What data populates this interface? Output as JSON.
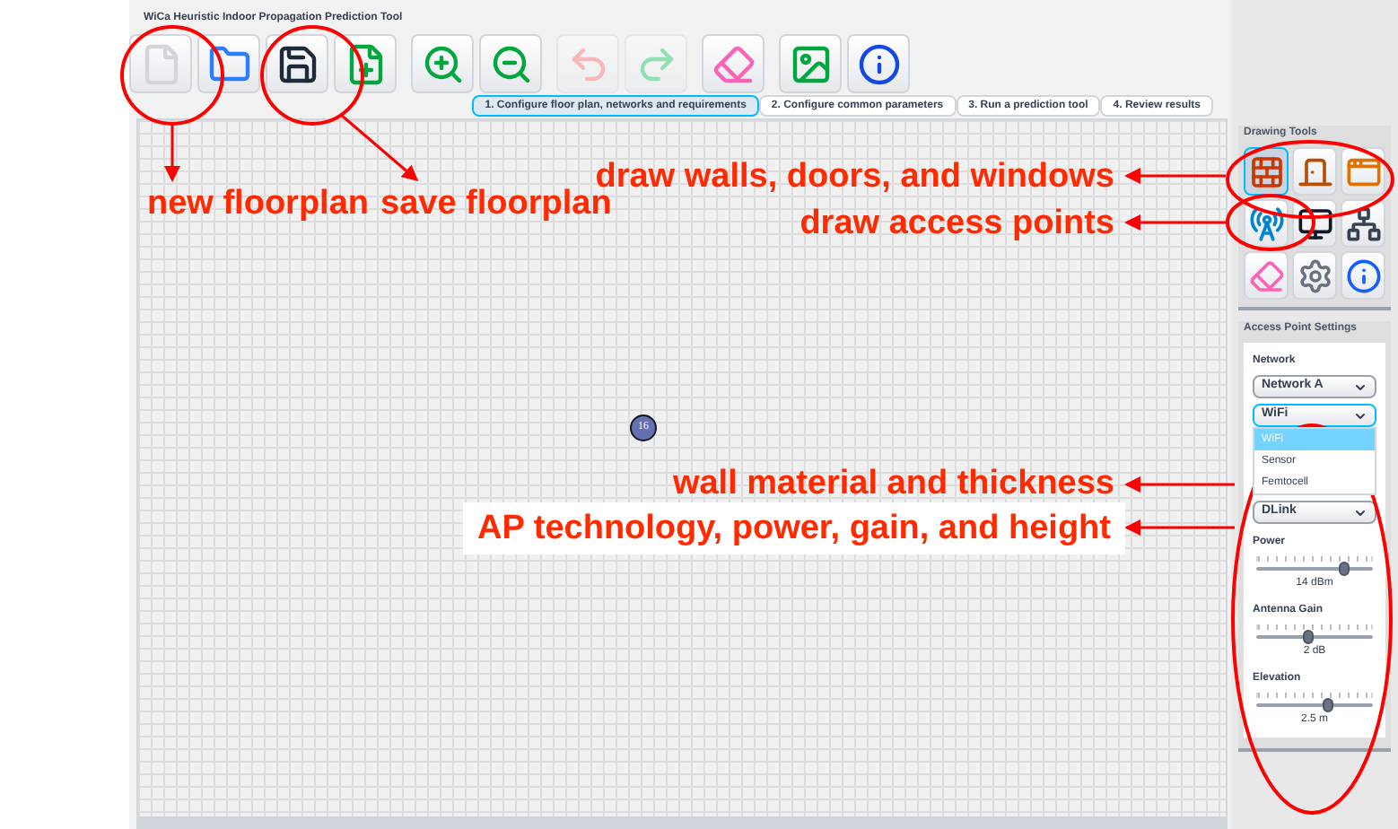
{
  "window": {
    "title": "WiCa Heuristic Indoor Propagation Prediction Tool"
  },
  "toolbar": [
    {
      "kind": "new",
      "disabled": false
    },
    {
      "kind": "open",
      "disabled": false
    },
    {
      "kind": "save",
      "disabled": false
    },
    {
      "kind": "add-sheet",
      "disabled": false
    },
    {
      "kind": "zoom-in",
      "disabled": false
    },
    {
      "kind": "zoom-out",
      "disabled": false
    },
    {
      "kind": "undo",
      "disabled": true
    },
    {
      "kind": "redo",
      "disabled": true
    },
    {
      "kind": "eraser",
      "disabled": false
    },
    {
      "kind": "image",
      "disabled": false
    },
    {
      "kind": "info",
      "disabled": false
    }
  ],
  "tabs": [
    {
      "label": "1. Configure floor plan, networks and requirements",
      "selected": true
    },
    {
      "label": "2. Configure common parameters",
      "selected": false
    },
    {
      "label": "3. Run a prediction tool",
      "selected": false
    },
    {
      "label": "4. Review results",
      "selected": false
    }
  ],
  "canvas": {
    "access_points": [
      {
        "label": "16"
      }
    ]
  },
  "drawing_tools": {
    "title": "Drawing Tools",
    "tools": [
      {
        "kind": "wall",
        "selected": true
      },
      {
        "kind": "door",
        "selected": false
      },
      {
        "kind": "window",
        "selected": false
      },
      {
        "kind": "access-point",
        "selected": false
      },
      {
        "kind": "screen",
        "selected": false
      },
      {
        "kind": "network",
        "selected": false
      },
      {
        "kind": "eraser",
        "selected": false
      },
      {
        "kind": "settings",
        "selected": false
      },
      {
        "kind": "info",
        "selected": false
      }
    ]
  },
  "ap_settings": {
    "title": "Access Point Settings",
    "network_label": "Network",
    "network": "Network A",
    "technology": {
      "value": "WiFi",
      "expanded": true,
      "options": [
        {
          "label": "WiFi",
          "selected": true
        },
        {
          "label": "Sensor",
          "selected": false
        },
        {
          "label": "Femtocell",
          "selected": false
        }
      ]
    },
    "vendor": "DLink",
    "sliders": [
      {
        "label": "Power",
        "level": 0.75,
        "reading": "14 dBm"
      },
      {
        "label": "Antenna Gain",
        "level": 0.45,
        "reading": "2 dB"
      },
      {
        "label": "Elevation",
        "level": 0.62,
        "reading": "2.5 m"
      }
    ]
  },
  "annotations": [
    {
      "text": "new floorplan",
      "boxed": false
    },
    {
      "text": "save floorplan",
      "boxed": false
    },
    {
      "text": "draw walls, doors, and windows",
      "boxed": false
    },
    {
      "text": "draw access points",
      "boxed": false
    },
    {
      "text": "wall material and thickness",
      "boxed": false
    },
    {
      "text": "AP technology, power, gain, and height",
      "boxed": true
    }
  ]
}
